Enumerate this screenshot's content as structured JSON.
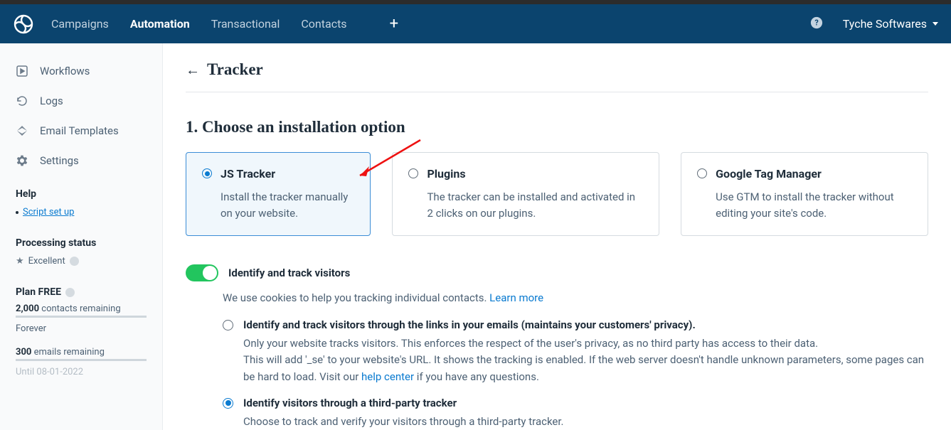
{
  "topbar": {
    "nav": [
      "Campaigns",
      "Automation",
      "Transactional",
      "Contacts"
    ],
    "active_index": 1,
    "account_name": "Tyche Softwares"
  },
  "sidebar": {
    "items": [
      {
        "label": "Workflows"
      },
      {
        "label": "Logs"
      },
      {
        "label": "Email Templates"
      },
      {
        "label": "Settings"
      }
    ],
    "help_heading": "Help",
    "help_link": "Script set up",
    "processing_heading": "Processing status",
    "processing_value": "Excellent",
    "plan_label": "Plan FREE",
    "contacts_count": "2,000",
    "contacts_remaining_label": "contacts remaining",
    "forever_label": "Forever",
    "emails_count": "300",
    "emails_remaining_label": "emails remaining",
    "until_label": "Until 08-01-2022"
  },
  "page": {
    "title": "Tracker",
    "section_heading": "1. Choose an installation option"
  },
  "cards": [
    {
      "title": "JS Tracker",
      "desc": "Install the tracker manually on your website."
    },
    {
      "title": "Plugins",
      "desc": "The tracker can be installed and activated in 2 clicks on our plugins."
    },
    {
      "title": "Google Tag Manager",
      "desc": "Use GTM to install the tracker without editing your site's code."
    }
  ],
  "toggle": {
    "label": "Identify and track visitors",
    "cookie_text": "We use cookies to help you tracking individual contacts. ",
    "learn_more": "Learn more"
  },
  "options": [
    {
      "title": "Identify and track visitors through the links in your emails (maintains your customers' privacy).",
      "desc_1": "Only your website tracks visitors. This enforces the respect of the user's privacy, as no third party has access to their data.",
      "desc_2a": "This will add '_se' to your website's URL. It shows the tracking is enabled. If the web server doesn't handle unknown parameters, some pages can be hard to load. Visit our ",
      "help_center": "help center",
      "desc_2b": " if you have any questions."
    },
    {
      "title": "Identify visitors through a third-party tracker",
      "desc_1": "Choose to track and verify your visitors through a third-party tracker."
    }
  ]
}
